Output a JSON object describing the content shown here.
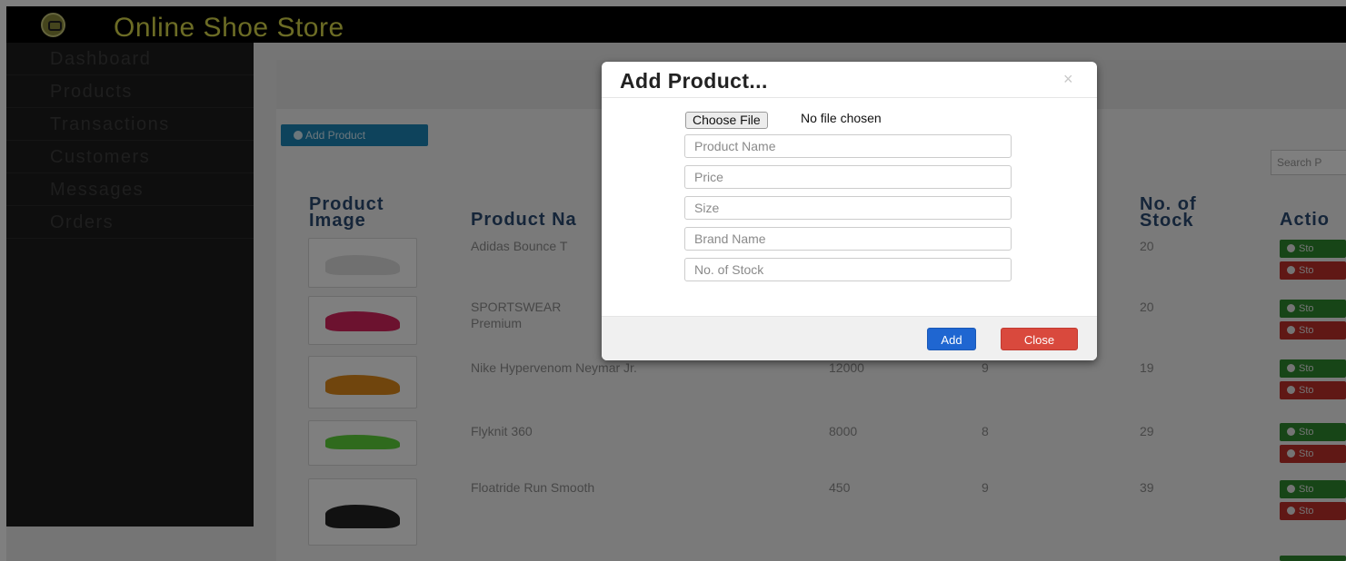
{
  "header": {
    "app_title": "Online Shoe Store",
    "logo_icon": "shoe-logo-icon"
  },
  "sidebar": {
    "items": [
      {
        "label": "Dashboard"
      },
      {
        "label": "Products"
      },
      {
        "label": "Transactions"
      },
      {
        "label": "Customers"
      },
      {
        "label": "Messages"
      },
      {
        "label": "Orders"
      }
    ]
  },
  "toolbar": {
    "add_product_label": "Add Product",
    "search_placeholder": "Search P"
  },
  "table": {
    "headers": {
      "image": "Product Image",
      "name": "Product Na",
      "stock": "No. of Stock",
      "action": "Actio"
    },
    "rows": [
      {
        "name": "Adidas Bounce T",
        "price": "",
        "size": "",
        "stock": "20",
        "shoe_color": "#e0e0e0"
      },
      {
        "name": "SPORTSWEAR Premium",
        "price": "",
        "size": "",
        "stock": "20",
        "shoe_color": "#d8245e"
      },
      {
        "name": "Nike Hypervenom Neymar Jr.",
        "price": "12000",
        "size": "9",
        "stock": "19",
        "shoe_color": "#e08a1a"
      },
      {
        "name": "Flyknit 360",
        "price": "8000",
        "size": "8",
        "stock": "29",
        "shoe_color": "#5fd43a"
      },
      {
        "name": "Floatride Run Smooth",
        "price": "450",
        "size": "9",
        "stock": "39",
        "shoe_color": "#222222"
      }
    ],
    "action_add_label": "Sto",
    "action_remove_label": "Sto"
  },
  "modal": {
    "title": "Add Product...",
    "close_glyph": "×",
    "file_button_label": "Choose File",
    "file_status": "No file chosen",
    "placeholders": {
      "product_name": "Product Name",
      "price": "Price",
      "size": "Size",
      "brand_name": "Brand Name",
      "stock": "No. of Stock"
    },
    "add_label": "Add",
    "close_label": "Close"
  },
  "colors": {
    "brand_yellow": "#d9d94a",
    "primary_blue": "#1f66d1",
    "danger_red": "#d9493d",
    "success_green": "#2e8b2e"
  }
}
